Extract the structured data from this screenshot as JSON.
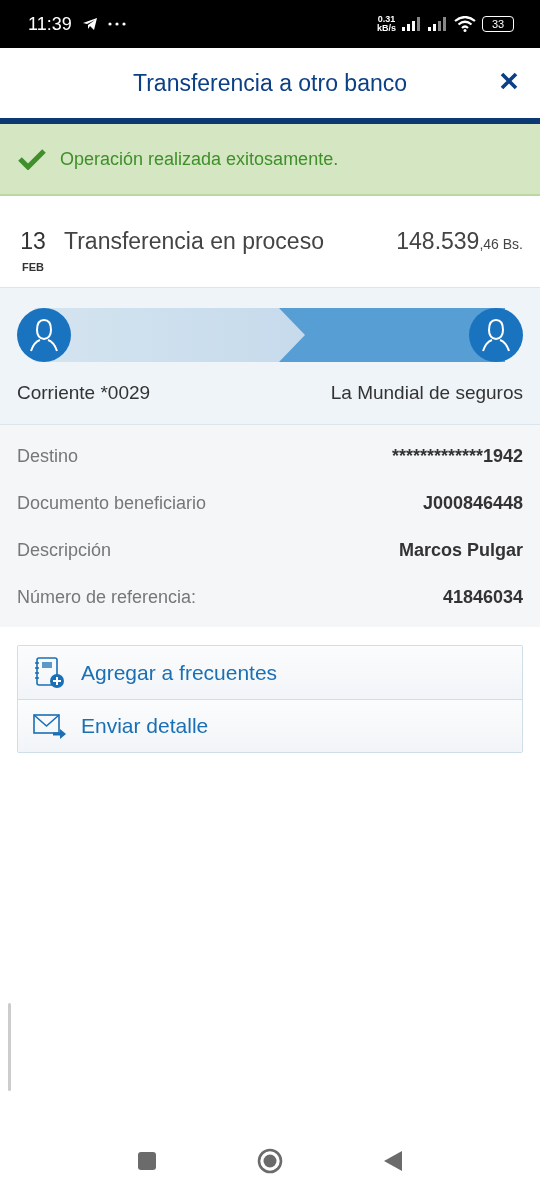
{
  "status_bar": {
    "time": "11:39",
    "speed_value": "0.31",
    "speed_unit": "kB/s",
    "battery": "33"
  },
  "header": {
    "title": "Transferencia a otro banco"
  },
  "banner": {
    "message": "Operación realizada exitosamente."
  },
  "transaction": {
    "day": "13",
    "month": "FEB",
    "description": "Transferencia en proceso",
    "amount": "148.539",
    "amount_decimals": ",46 Bs."
  },
  "transfer": {
    "from": "Corriente *0029",
    "to": "La Mundial de seguros"
  },
  "details": [
    {
      "label": "Destino",
      "value": "*************1942"
    },
    {
      "label": "Documento beneficiario",
      "value": "J000846448"
    },
    {
      "label": "Descripción",
      "value": "Marcos Pulgar"
    },
    {
      "label": "Número de referencia:",
      "value": "41846034"
    }
  ],
  "actions": [
    {
      "kind": "add-frequent",
      "label": "Agregar a frecuentes"
    },
    {
      "kind": "send-detail",
      "label": "Enviar detalle"
    }
  ]
}
